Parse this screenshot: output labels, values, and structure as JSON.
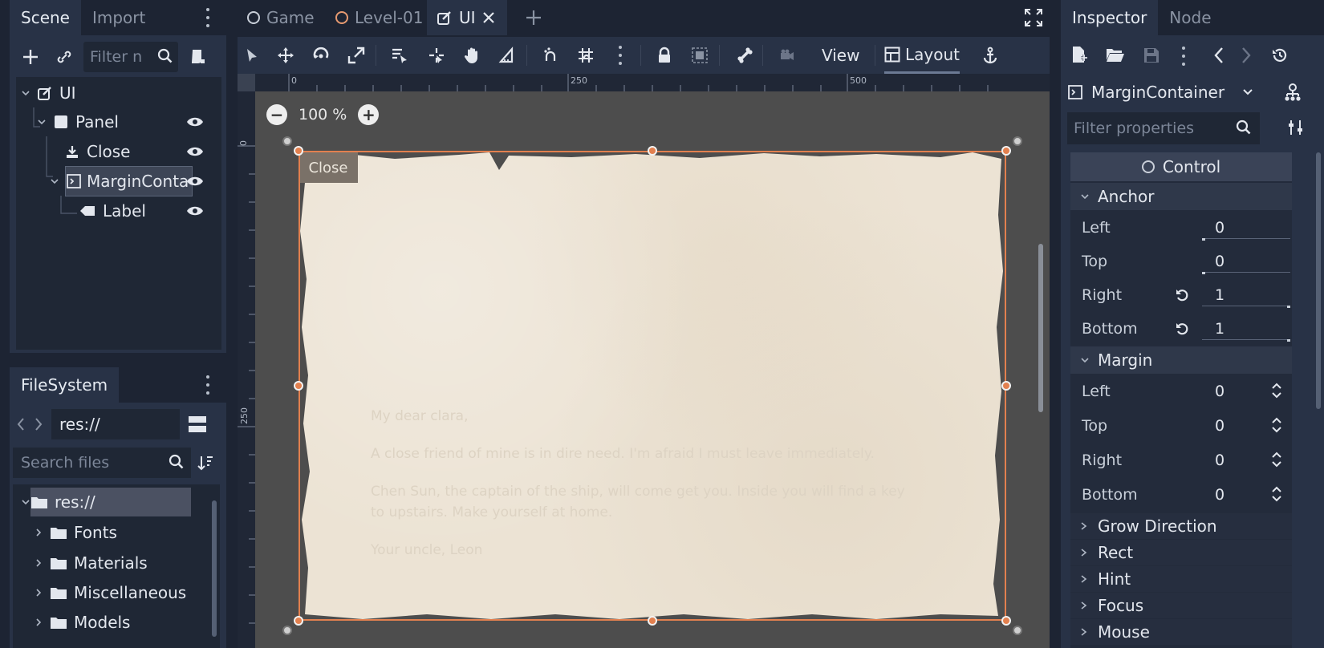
{
  "scene_dock": {
    "tabs": [
      "Scene",
      "Import"
    ],
    "filter_placeholder": "Filter n",
    "nodes": [
      "UI",
      "Panel",
      "Close",
      "MarginConta",
      "Label"
    ]
  },
  "filesystem_dock": {
    "tab": "FileSystem",
    "path": "res://",
    "search_placeholder": "Search files",
    "items": [
      "res://",
      "Fonts",
      "Materials",
      "Miscellaneous",
      "Models"
    ]
  },
  "editor_tabs": [
    "Game",
    "Level-01",
    "UI"
  ],
  "toolbar": {
    "view_label": "View",
    "layout_label": "Layout"
  },
  "viewport": {
    "zoom": "100 %",
    "ruler_labels": {
      "h": [
        "0",
        "250",
        "500"
      ],
      "v": [
        "0",
        "250"
      ]
    },
    "close_button": "Close",
    "letter_lines": [
      "My dear clara,",
      "A close friend of mine is in dire need. I'm afraid I must leave immediately.",
      "Chen Sun, the captain of the ship, will come get you. Inside you will find a key to upstairs. Make yourself at home.",
      "Your uncle, Leon"
    ]
  },
  "inspector": {
    "tabs": [
      "Inspector",
      "Node"
    ],
    "class_name": "MarginContainer",
    "filter_placeholder": "Filter properties",
    "section": "Control",
    "anchor": {
      "title": "Anchor",
      "rows": [
        {
          "label": "Left",
          "value": "0"
        },
        {
          "label": "Top",
          "value": "0"
        },
        {
          "label": "Right",
          "value": "1"
        },
        {
          "label": "Bottom",
          "value": "1"
        }
      ]
    },
    "margin": {
      "title": "Margin",
      "rows": [
        {
          "label": "Left",
          "value": "0"
        },
        {
          "label": "Top",
          "value": "0"
        },
        {
          "label": "Right",
          "value": "0"
        },
        {
          "label": "Bottom",
          "value": "0"
        }
      ]
    },
    "collapsed_groups": [
      "Grow Direction",
      "Rect",
      "Hint",
      "Focus",
      "Mouse"
    ]
  },
  "colors": {
    "accent": "#e2804f",
    "panel": "#283246",
    "background": "#1d2433",
    "parchment": "#ece3d4"
  }
}
